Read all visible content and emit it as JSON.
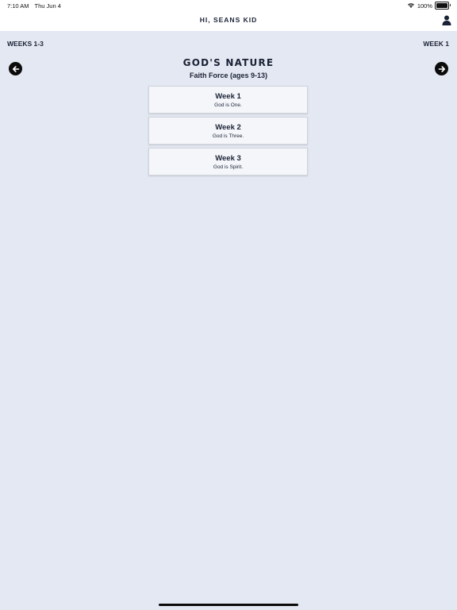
{
  "status_bar": {
    "time": "7:10 AM",
    "date": "Thu Jun 4",
    "battery": "100%"
  },
  "header": {
    "greeting": "HI, SEANS KID",
    "profile_icon": "person-icon"
  },
  "nav": {
    "range_label": "WEEKS 1-3",
    "current_week": "WEEK 1",
    "prev_icon": "arrow-left-icon",
    "next_icon": "arrow-right-icon"
  },
  "series": {
    "title": "GOD'S NATURE",
    "subtitle": "Faith Force (ages 9-13)"
  },
  "weeks": [
    {
      "title": "Week 1",
      "subtitle": "God is One."
    },
    {
      "title": "Week 2",
      "subtitle": "God is Three."
    },
    {
      "title": "Week 3",
      "subtitle": "God is Spirit."
    }
  ],
  "colors": {
    "background": "#e4e8f2",
    "text": "#1a2235",
    "header_bg": "#ffffff",
    "card_bg": "#f5f6fa",
    "nav_button": "#0b0b0b"
  }
}
